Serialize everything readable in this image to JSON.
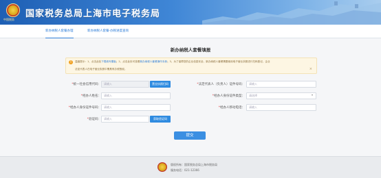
{
  "header": {
    "site_title": "国家税务总局上海市电子税务局",
    "emblem_caption": "中国税务"
  },
  "tabs": [
    {
      "label": "新办纳税人套餐办理",
      "active": true
    },
    {
      "label": "新办纳税人套餐-办税进度查询",
      "active": false
    }
  ],
  "form": {
    "title": "新办纳税人套餐填报",
    "notice": {
      "line1_prefix": "温馨提示：1、点击此处",
      "line1_link1": "下载填写模板",
      "line1_mid": "；2、点击此处可查看",
      "line1_link2": "新办纳税人套餐操作手册",
      "line1_suffix": "；3、为了保障您的企业信息安全，新办纳税人套餐需要使用电子营业执照进行扫码登记，企业",
      "line2": "法定代表人在电子营业执照中需具有办税授权。",
      "close": "×"
    },
    "fields": {
      "credit_code": {
        "label": "统一社会信用代码：",
        "placeholder": "请输入",
        "button": "营业执照扫码"
      },
      "legal_rep_id": {
        "label": "法定代表人（负责人）证件号码：",
        "placeholder": "请输入"
      },
      "agent_name": {
        "label": "经办人姓名：",
        "placeholder": "请输入"
      },
      "agent_id_type": {
        "label": "经办人身份证件类型：",
        "placeholder": "请选择",
        "arrow": "▾"
      },
      "agent_id_no": {
        "label": "经办人身份证件号码：",
        "placeholder": "请输入"
      },
      "agent_mobile": {
        "label": "经办人移动电话：",
        "placeholder": "请输入"
      },
      "captcha": {
        "label": "验证码：",
        "placeholder": "请输入",
        "button": "获取验证码"
      }
    },
    "required_mark": "*",
    "submit": "提交"
  },
  "footer": {
    "copyright": "版权所有：国家税务总局上海市税务局",
    "hotline": "服务电话：021-12366"
  },
  "colors": {
    "primary": "#2f8be0",
    "header": "#1e5fb4",
    "notice_bg": "#fdf6e3"
  }
}
